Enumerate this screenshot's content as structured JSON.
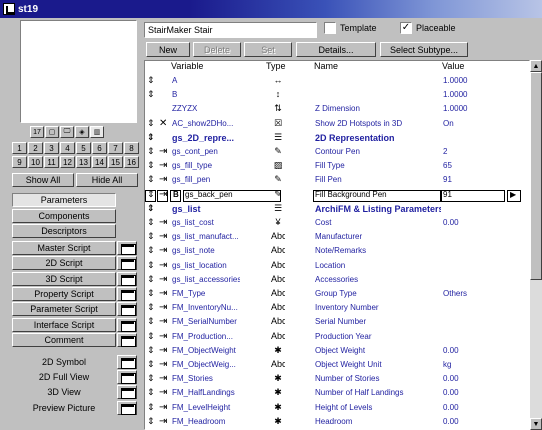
{
  "window": {
    "title": "st19"
  },
  "icon_row": [
    "17",
    "▢",
    "🖵",
    "◈",
    "▥"
  ],
  "num_row1": [
    "1",
    "2",
    "3",
    "4",
    "5",
    "6",
    "7",
    "8"
  ],
  "num_row2": [
    "9",
    "10",
    "11",
    "12",
    "13",
    "14",
    "15",
    "16"
  ],
  "buttons": {
    "show_all": "Show All",
    "hide_all": "Hide All",
    "new": "New",
    "delete": "Delete",
    "set": "Set",
    "details": "Details...",
    "select_subtype": "Select Subtype..."
  },
  "tabs": {
    "parameters": "Parameters",
    "components": "Components",
    "descriptors": "Descriptors"
  },
  "scripts": [
    "Master Script",
    "2D Script",
    "3D Script",
    "Property Script",
    "Parameter Script",
    "Interface Script",
    "Comment"
  ],
  "views": [
    "2D Symbol",
    "2D Full View",
    "3D View",
    "Preview Picture"
  ],
  "name_field": "StairMaker Stair",
  "checkboxes": {
    "template": "Template",
    "template_checked": false,
    "placeable": "Placeable",
    "placeable_checked": true,
    "check_mark": "✓"
  },
  "columns": {
    "variable": "Variable",
    "type": "Type",
    "name": "Name",
    "value": "Value"
  },
  "rows": [
    {
      "ctrl": "⇕",
      "hid": "",
      "var": "A",
      "type": "↔",
      "name": "",
      "val": "1.0000"
    },
    {
      "ctrl": "⇕",
      "hid": "",
      "var": "B",
      "type": "↕",
      "name": "",
      "val": "1.0000"
    },
    {
      "ctrl": "",
      "hid": "",
      "var": "ZZYZX",
      "type": "⇅",
      "name": "Z Dimension",
      "val": "1.0000"
    },
    {
      "ctrl": "⇕",
      "hid": "✕",
      "var": "AC_show2DHo...",
      "type": "☒",
      "name": "Show 2D Hotspots in 3D",
      "val": "On"
    },
    {
      "ctrl": "⇕",
      "hid": "",
      "var": "gs_2D_repre...",
      "type": "☰",
      "name": "2D Representation",
      "val": "",
      "heading": true
    },
    {
      "ctrl": "⇕",
      "hid": "⇥",
      "var": "gs_cont_pen",
      "type": "✎",
      "name": "Contour Pen",
      "val": "2"
    },
    {
      "ctrl": "⇕",
      "hid": "⇥",
      "var": "gs_fill_type",
      "type": "▨",
      "name": "Fill Type",
      "val": "65"
    },
    {
      "ctrl": "⇕",
      "hid": "⇥",
      "var": "gs_fill_pen",
      "type": "✎",
      "name": "Fill Pen",
      "val": "91"
    },
    {
      "ctrl": "⇕",
      "hid": "⇥",
      "var": "gs_back_pen",
      "type": "✎",
      "name": "Fill Background Pen",
      "val": "91",
      "selected": true,
      "arrow": "▶",
      "bold_tag": "B"
    },
    {
      "ctrl": "⇕",
      "hid": "",
      "var": "gs_list",
      "type": "☰",
      "name": "ArchiFM & Listing Parameters",
      "val": "",
      "heading": true
    },
    {
      "ctrl": "⇕",
      "hid": "⇥",
      "var": "gs_list_cost",
      "type": "¥",
      "name": "Cost",
      "val": "0.00"
    },
    {
      "ctrl": "⇕",
      "hid": "⇥",
      "var": "gs_list_manufact...",
      "type": "Abc",
      "name": "Manufacturer",
      "val": ""
    },
    {
      "ctrl": "⇕",
      "hid": "⇥",
      "var": "gs_list_note",
      "type": "Abc",
      "name": "Note/Remarks",
      "val": ""
    },
    {
      "ctrl": "⇕",
      "hid": "⇥",
      "var": "gs_list_location",
      "type": "Abc",
      "name": "Location",
      "val": ""
    },
    {
      "ctrl": "⇕",
      "hid": "⇥",
      "var": "gs_list_accessories",
      "type": "Abc",
      "name": "Accessories",
      "val": ""
    },
    {
      "ctrl": "⇕",
      "hid": "⇥",
      "var": "FM_Type",
      "type": "Abc",
      "name": "Group Type",
      "val": "Others"
    },
    {
      "ctrl": "⇕",
      "hid": "⇥",
      "var": "FM_InventoryNu...",
      "type": "Abc",
      "name": "Inventory Number",
      "val": ""
    },
    {
      "ctrl": "⇕",
      "hid": "⇥",
      "var": "FM_SerialNumber",
      "type": "Abc",
      "name": "Serial Number",
      "val": ""
    },
    {
      "ctrl": "⇕",
      "hid": "⇥",
      "var": "FM_Production...",
      "type": "Abc",
      "name": "Production Year",
      "val": ""
    },
    {
      "ctrl": "⇕",
      "hid": "⇥",
      "var": "FM_ObjectWeight",
      "type": "✱",
      "name": "Object Weight",
      "val": "0.00"
    },
    {
      "ctrl": "⇕",
      "hid": "⇥",
      "var": "FM_ObjectWeig...",
      "type": "Abc",
      "name": "Object Weight Unit",
      "val": "kg"
    },
    {
      "ctrl": "⇕",
      "hid": "⇥",
      "var": "FM_Stories",
      "type": "✱",
      "name": "Number of Stories",
      "val": "0.00"
    },
    {
      "ctrl": "⇕",
      "hid": "⇥",
      "var": "FM_HalfLandings",
      "type": "✱",
      "name": "Number of Half Landings",
      "val": "0.00"
    },
    {
      "ctrl": "⇕",
      "hid": "⇥",
      "var": "FM_LevelHeight",
      "type": "✱",
      "name": "Height of Levels",
      "val": "0.00"
    },
    {
      "ctrl": "⇕",
      "hid": "⇥",
      "var": "FM_Headroom",
      "type": "✱",
      "name": "Headroom",
      "val": "0.00"
    }
  ],
  "scroll": {
    "up": "▲",
    "down": "▼"
  }
}
